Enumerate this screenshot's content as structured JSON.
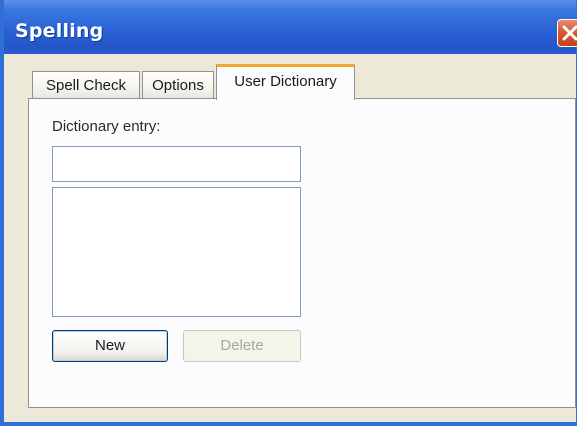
{
  "window": {
    "title": "Spelling",
    "close_icon": "close-x-icon"
  },
  "tabs": [
    {
      "label": "Spell Check",
      "active": false
    },
    {
      "label": "Options",
      "active": false
    },
    {
      "label": "User Dictionary",
      "active": true
    }
  ],
  "user_dictionary": {
    "entry_label": "Dictionary entry:",
    "entry_value": "",
    "entries": [],
    "new_label": "New",
    "delete_label": "Delete",
    "delete_enabled": false
  },
  "colors": {
    "title_bar": "#2a63d6",
    "active_tab_accent": "#f0a833",
    "close_button": "#d95a35"
  }
}
